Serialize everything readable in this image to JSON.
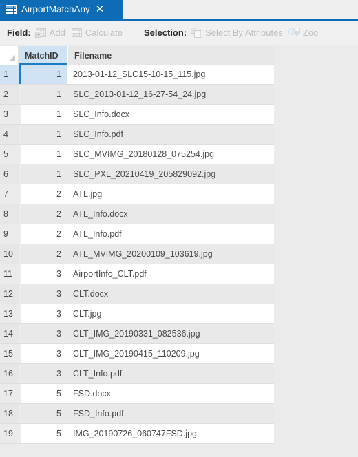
{
  "window": {
    "tab": {
      "label": "AirportMatchAny",
      "icon": "table-icon",
      "close_label": "✕"
    }
  },
  "toolbar": {
    "field_group_label": "Field:",
    "field_actions": [
      {
        "label": "Add",
        "icon": "add-field-icon",
        "enabled": false
      },
      {
        "label": "Calculate",
        "icon": "calculate-field-icon",
        "enabled": false
      }
    ],
    "selection_group_label": "Selection:",
    "selection_actions": [
      {
        "label": "Select By Attributes",
        "icon": "select-by-attributes-icon",
        "enabled": false
      },
      {
        "label": "Zoo",
        "icon": "zoom-to-selection-icon",
        "enabled": false
      }
    ]
  },
  "table": {
    "columns": [
      {
        "key": "rownum",
        "label": ""
      },
      {
        "key": "matchid",
        "label": "MatchID",
        "active": true
      },
      {
        "key": "filename",
        "label": "Filename",
        "active": false
      }
    ],
    "selected_row_index": 1,
    "rows": [
      {
        "rownum": "1",
        "matchid": "1",
        "filename": "2013-01-12_SLC15-10-15_115.jpg"
      },
      {
        "rownum": "2",
        "matchid": "1",
        "filename": "SLC_2013-01-12_16-27-54_24.jpg"
      },
      {
        "rownum": "3",
        "matchid": "1",
        "filename": "SLC_Info.docx"
      },
      {
        "rownum": "4",
        "matchid": "1",
        "filename": "SLC_Info.pdf"
      },
      {
        "rownum": "5",
        "matchid": "1",
        "filename": "SLC_MVIMG_20180128_075254.jpg"
      },
      {
        "rownum": "6",
        "matchid": "1",
        "filename": "SLC_PXL_20210419_205829092.jpg"
      },
      {
        "rownum": "7",
        "matchid": "2",
        "filename": "ATL.jpg"
      },
      {
        "rownum": "8",
        "matchid": "2",
        "filename": "ATL_Info.docx"
      },
      {
        "rownum": "9",
        "matchid": "2",
        "filename": "ATL_Info.pdf"
      },
      {
        "rownum": "10",
        "matchid": "2",
        "filename": "ATL_MVIMG_20200109_103619.jpg"
      },
      {
        "rownum": "11",
        "matchid": "3",
        "filename": "AirportInfo_CLT.pdf"
      },
      {
        "rownum": "12",
        "matchid": "3",
        "filename": "CLT.docx"
      },
      {
        "rownum": "13",
        "matchid": "3",
        "filename": "CLT.jpg"
      },
      {
        "rownum": "14",
        "matchid": "3",
        "filename": "CLT_IMG_20190331_082536.jpg"
      },
      {
        "rownum": "15",
        "matchid": "3",
        "filename": "CLT_IMG_20190415_110209.jpg"
      },
      {
        "rownum": "16",
        "matchid": "3",
        "filename": "CLT_Info.pdf"
      },
      {
        "rownum": "17",
        "matchid": "5",
        "filename": "FSD.docx"
      },
      {
        "rownum": "18",
        "matchid": "5",
        "filename": "FSD_Info.pdf"
      },
      {
        "rownum": "19",
        "matchid": "5",
        "filename": "IMG_20190726_060747FSD.jpg"
      }
    ]
  },
  "colors": {
    "tab_active": "#0d6cb5",
    "selection_blue": "#1b7ec4",
    "selection_fill": "#cfe3f5",
    "row_alt": "#e9e9e9",
    "panel_bg": "#ebebeb"
  }
}
